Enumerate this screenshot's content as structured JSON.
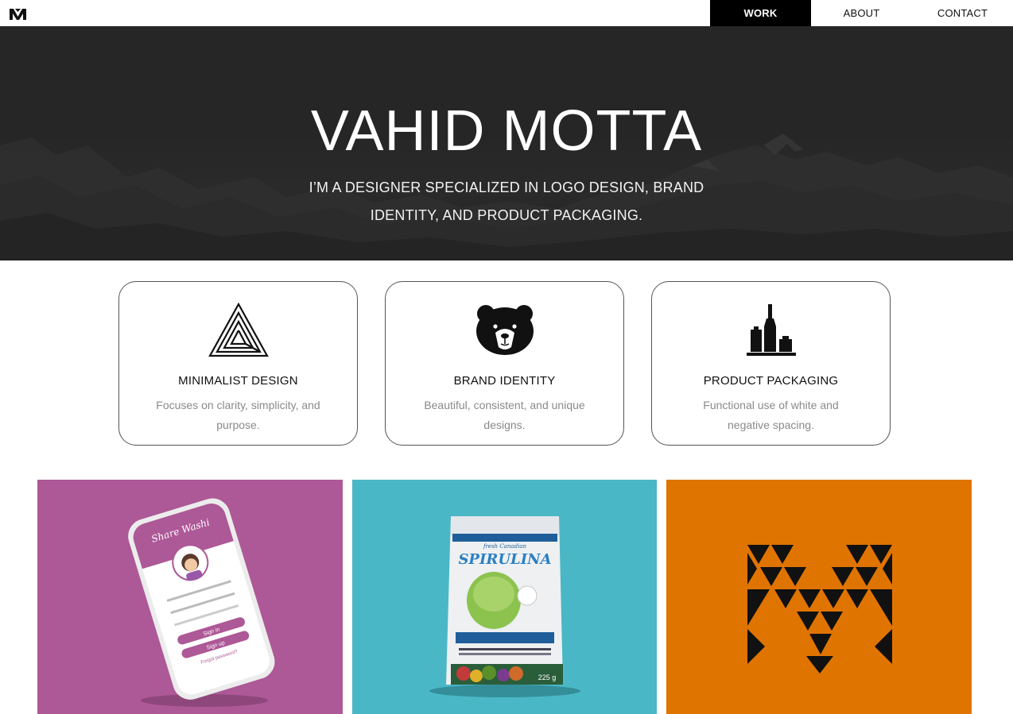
{
  "nav": {
    "logo_icon": "vm-monogram-icon",
    "links": [
      {
        "label": "WORK",
        "active": true
      },
      {
        "label": "ABOUT",
        "active": false
      },
      {
        "label": "CONTACT",
        "active": false
      }
    ]
  },
  "hero": {
    "title": "VAHID MOTTA",
    "subtitle": "I’M A DESIGNER SPECIALIZED IN LOGO DESIGN, BRAND IDENTITY, AND PRODUCT PACKAGING."
  },
  "features": [
    {
      "icon": "triangle-maze-icon",
      "title": "MINIMALIST DESIGN",
      "description": "Focuses on clarity, simplicity, and purpose."
    },
    {
      "icon": "bear-head-icon",
      "title": "BRAND IDENTITY",
      "description": "Beautiful, consistent, and unique designs."
    },
    {
      "icon": "bottles-icon",
      "title": "PRODUCT PACKAGING",
      "description": "Functional use of white and negative spacing."
    }
  ],
  "portfolio": {
    "tiles": [
      {
        "subject": "share-washi-app-phone-mockup",
        "background": "#ad5897",
        "phone_header": "Share Washi",
        "buttons": [
          "Sign in",
          "Sign up"
        ],
        "link": "Forgot password?"
      },
      {
        "subject": "spirulina-pouch-packaging",
        "background": "#4ab7c6",
        "brand_small": "fresh Canadian",
        "brand": "SPIRULINA",
        "weight": "225 g"
      },
      {
        "subject": "vm-triangle-logo",
        "background": "#e07400"
      }
    ]
  },
  "colors": {
    "nav_active_bg": "#000000",
    "hero_bg": "#262626",
    "card_border": "#555555",
    "tile_purple": "#ad5897",
    "tile_teal": "#4ab7c6",
    "tile_orange": "#e07400"
  }
}
